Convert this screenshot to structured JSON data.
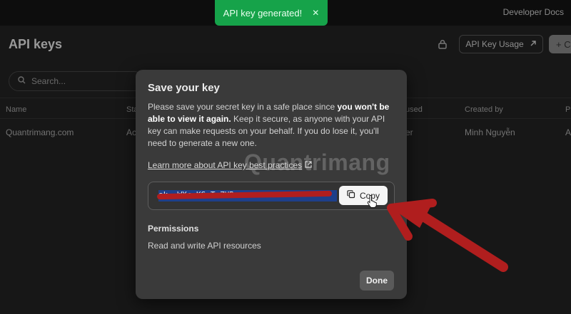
{
  "topbar": {
    "developer_docs": "Developer Docs"
  },
  "toast": {
    "message": "API key generated!",
    "close_symbol": "✕"
  },
  "page": {
    "title": "API keys",
    "usage_button": "API Key Usage",
    "usage_icon": "arrow-up-right-icon",
    "create_button": "+ C",
    "search_placeholder": "Search...",
    "table": {
      "headers": [
        "Name",
        "Sta",
        "used",
        "Created by",
        "P"
      ],
      "row": [
        "Quantrimang.com",
        "Ac",
        "er",
        "Minh Nguyễn",
        "A"
      ]
    }
  },
  "modal": {
    "title": "Save your key",
    "desc_part1": "Please save your secret key in a safe place since ",
    "desc_bold": "you won't be able to view it again.",
    "desc_part2": " Keep it secure, as anyone with your API key can make requests on your behalf. If you do lose it, you'll need to generate a new one.",
    "learn_more": "Learn more about API key best practices",
    "key_value": "sk-                           WXc  KSzT  ZHRun",
    "copy_label": "Copy",
    "permissions_title": "Permissions",
    "permissions_value": "Read and write API resources",
    "done_label": "Done"
  },
  "watermark": "Quantrimang",
  "colors": {
    "toast": "#16a34a",
    "annotation": "#b01e1e",
    "modal_bg": "#3a3a3a"
  }
}
